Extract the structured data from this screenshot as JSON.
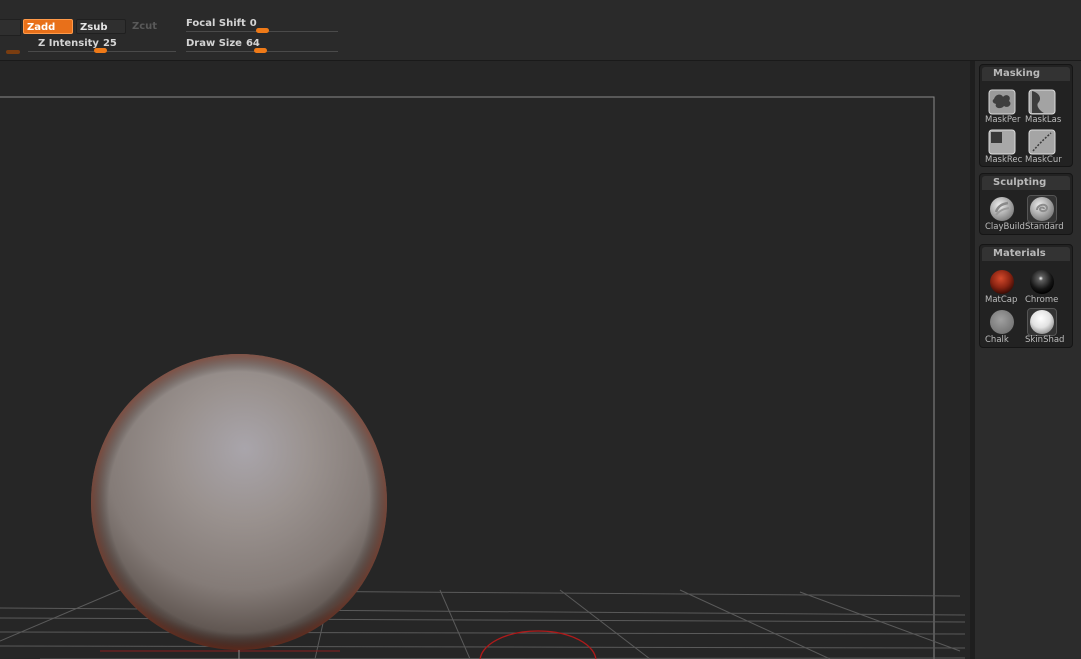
{
  "toolbar": {
    "zadd_label": "Zadd",
    "zsub_label": "Zsub",
    "zcut_label": "Zcut",
    "z_intensity": {
      "label": "Z Intensity",
      "value": "25"
    },
    "focal_shift": {
      "label": "Focal Shift",
      "value": "0"
    },
    "draw_size": {
      "label": "Draw Size",
      "value": "64"
    }
  },
  "tray": {
    "masking": {
      "title": "Masking",
      "items": [
        {
          "label": "MaskPer",
          "icon": "mask-pen-icon"
        },
        {
          "label": "MaskLas",
          "icon": "mask-lasso-icon"
        },
        {
          "label": "MaskRec",
          "icon": "mask-rect-icon"
        },
        {
          "label": "MaskCur",
          "icon": "mask-curve-icon"
        }
      ]
    },
    "sculpting": {
      "title": "Sculpting",
      "items": [
        {
          "label": "ClayBuild",
          "icon": "claybuildup-brush-icon"
        },
        {
          "label": "Standard",
          "icon": "standard-brush-icon"
        }
      ]
    },
    "materials": {
      "title": "Materials",
      "items": [
        {
          "label": "MatCap",
          "icon": "matcap-red-icon"
        },
        {
          "label": "Chrome",
          "icon": "chrome-material-icon"
        },
        {
          "label": "Chalk",
          "icon": "chalk-material-icon"
        },
        {
          "label": "SkinShade",
          "icon": "skinshade-material-icon"
        }
      ]
    }
  },
  "colors": {
    "accent": "#e8701a",
    "slider_handle": "#ef7a18",
    "panel_bg": "#222222",
    "viewport_bg": "#262626"
  }
}
